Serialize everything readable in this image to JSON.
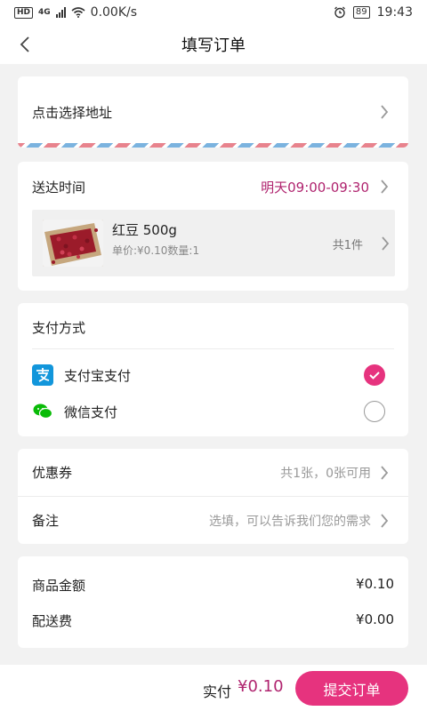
{
  "status_bar": {
    "hd": "HD",
    "network": "4G",
    "speed": "0.00K/s",
    "battery": "89",
    "time": "19:43"
  },
  "nav": {
    "title": "填写订单"
  },
  "address": {
    "label": "点击选择地址"
  },
  "delivery": {
    "label": "送达时间",
    "time": "明天09:00-09:30",
    "product": {
      "name": "红豆 500g",
      "price_qty": "单价:¥0.10数量:1",
      "count": "共1件"
    }
  },
  "payment": {
    "title": "支付方式",
    "options": [
      {
        "label": "支付宝支付",
        "selected": true,
        "icon": "alipay-icon",
        "color": "#1296db"
      },
      {
        "label": "微信支付",
        "selected": false,
        "icon": "wechat-icon",
        "color": "#09bb07"
      }
    ]
  },
  "extras": {
    "coupon": {
      "label": "优惠券",
      "value": "共1张，0张可用"
    },
    "note": {
      "label": "备注",
      "placeholder": "选填，可以告诉我们您的需求"
    }
  },
  "summary": {
    "goods_amount": {
      "label": "商品金额",
      "value": "¥0.10"
    },
    "shipping": {
      "label": "配送费",
      "value": "¥0.00"
    }
  },
  "bottom": {
    "total_label": "实付",
    "total_value": "¥0.10",
    "submit": "提交订单"
  },
  "colors": {
    "accent": "#e6337e",
    "accent_text": "#b0246f",
    "background": "#f2f2f2"
  }
}
